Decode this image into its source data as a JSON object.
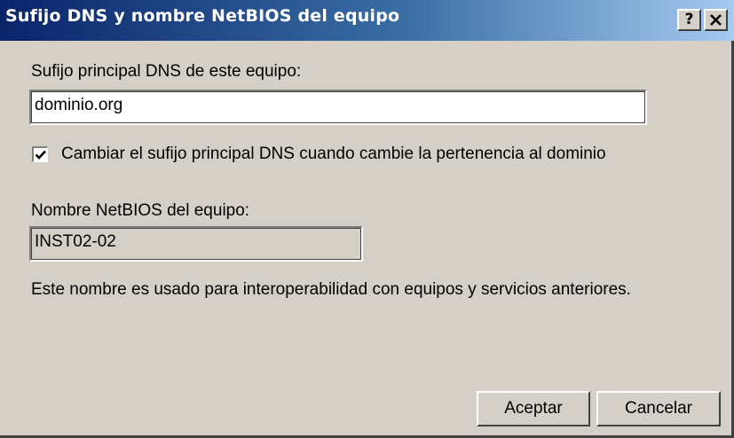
{
  "window": {
    "title": "Sufijo DNS y nombre NetBIOS del equipo",
    "help_label": "?",
    "close_label": "✕"
  },
  "dns": {
    "label": "Sufijo principal DNS de este equipo:",
    "value": "dominio.org"
  },
  "change_suffix": {
    "checked": true,
    "label": "Cambiar el sufijo principal DNS cuando cambie la pertenencia al dominio"
  },
  "netbios": {
    "label": "Nombre NetBIOS del equipo:",
    "value": "INST02-02"
  },
  "info_text": "Este nombre es usado para interoperabilidad con equipos y servicios anteriores.",
  "buttons": {
    "ok": "Aceptar",
    "cancel": "Cancelar"
  },
  "colors": {
    "titlebar_start": "#0a246a",
    "titlebar_end": "#a6caf0",
    "face": "#d4d0c8"
  }
}
